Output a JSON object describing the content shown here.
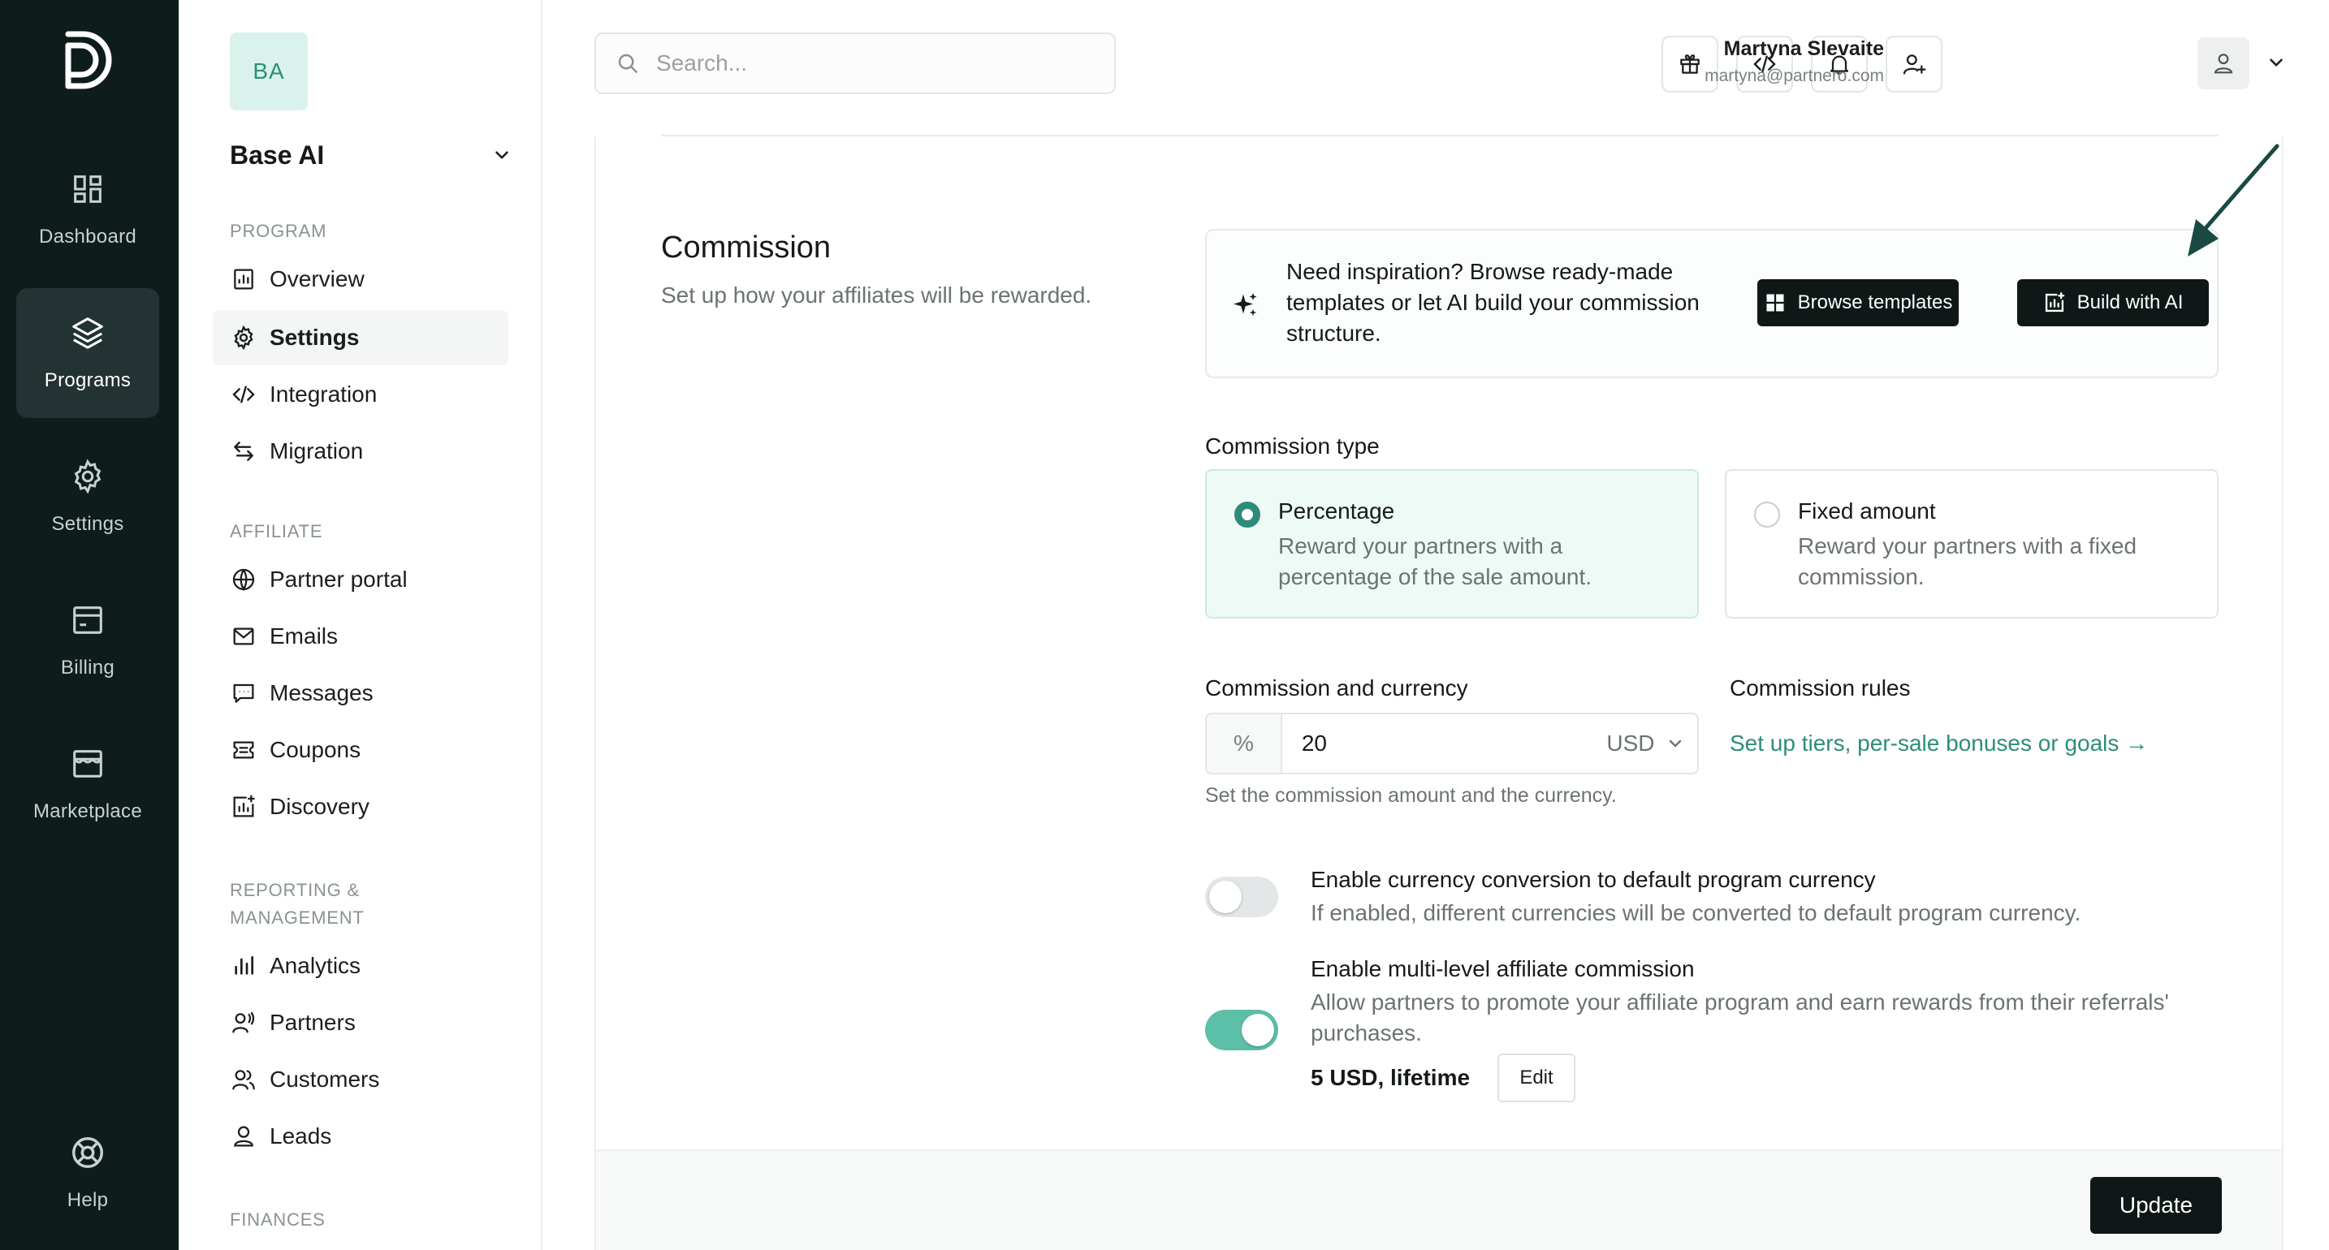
{
  "rail": {
    "items": [
      {
        "label": "Dashboard",
        "icon": "dashboard-icon"
      },
      {
        "label": "Programs",
        "icon": "layers-icon",
        "active": true
      },
      {
        "label": "Settings",
        "icon": "gear-icon"
      },
      {
        "label": "Billing",
        "icon": "billing-icon"
      },
      {
        "label": "Marketplace",
        "icon": "store-icon"
      }
    ],
    "help": {
      "label": "Help",
      "icon": "lifebuoy-icon"
    }
  },
  "sidebar": {
    "org_initials": "BA",
    "org_name": "Base AI",
    "sections": {
      "program": "PROGRAM",
      "affiliate": "AFFILIATE",
      "reporting": "REPORTING & MANAGEMENT",
      "finances": "FINANCES"
    },
    "program_items": [
      "Overview",
      "Settings",
      "Integration",
      "Migration"
    ],
    "affiliate_items": [
      "Partner portal",
      "Emails",
      "Messages",
      "Coupons",
      "Discovery"
    ],
    "reporting_items": [
      "Analytics",
      "Partners",
      "Customers",
      "Leads"
    ],
    "active_item": "Settings"
  },
  "topbar": {
    "search_placeholder": "Search...",
    "user_name": "Martyna Slevaite",
    "user_email": "martyna@partnero.com",
    "icons": [
      "gift-icon",
      "code-icon",
      "bell-icon",
      "user-plus-icon"
    ]
  },
  "commission": {
    "title": "Commission",
    "subtitle": "Set up how your affiliates will be rewarded.",
    "inspiration_text": "Need inspiration? Browse ready-made templates or let AI build your commission structure.",
    "browse_label": "Browse templates",
    "build_ai_label": "Build with AI",
    "type_label": "Commission type",
    "types": [
      {
        "title": "Percentage",
        "desc": "Reward your partners with a percentage of the sale amount.",
        "selected": true
      },
      {
        "title": "Fixed amount",
        "desc": "Reward your partners with a fixed commission.",
        "selected": false
      }
    ],
    "amount_label": "Commission and currency",
    "amount_prefix": "%",
    "amount_value": "20",
    "currency": "USD",
    "amount_help": "Set the commission amount and the currency.",
    "rules_label": "Commission rules",
    "rules_link": "Set up tiers, per-sale bonuses or goals →",
    "options": [
      {
        "title": "Enable currency conversion to default program currency",
        "desc": "If enabled, different currencies will be converted to default program currency.",
        "enabled": false
      },
      {
        "title": "Enable multi-level affiliate commission",
        "desc": "Allow partners to promote your affiliate program and earn rewards from their referrals' purchases.",
        "enabled": true
      }
    ],
    "multilevel_value": "5 USD, lifetime",
    "edit_label": "Edit",
    "update_label": "Update"
  },
  "colors": {
    "accent": "#2d8e78",
    "toggle_on": "#5cbfa7",
    "rail_bg": "#0f1c1c",
    "button_dark": "#0f1717"
  }
}
